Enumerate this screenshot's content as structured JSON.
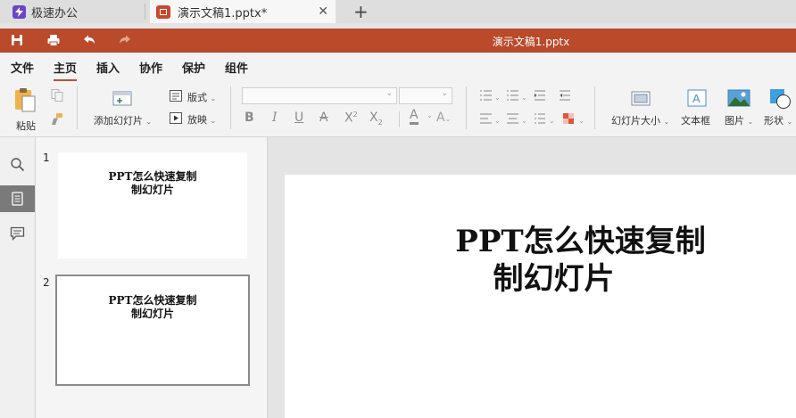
{
  "tabs": [
    {
      "label": "极速办公"
    },
    {
      "label": "演示文稿1.pptx*"
    }
  ],
  "titlebar": {
    "title": "演示文稿1.pptx"
  },
  "menu": [
    "文件",
    "主页",
    "插入",
    "协作",
    "保护",
    "组件"
  ],
  "ribbon": {
    "paste": "粘贴",
    "add_slide": "添加幻灯片",
    "layout": "版式",
    "play": "放映",
    "slide_size": "幻灯片大小",
    "textbox": "文本框",
    "image": "图片",
    "shape": "形状"
  },
  "slides": [
    {
      "number": "1",
      "line1": "PPT怎么快速复制",
      "line2": "制幻灯片"
    },
    {
      "number": "2",
      "line1": "PPT怎么快速复制",
      "line2": "制幻灯片"
    }
  ],
  "main_slide": {
    "line1": "PPT怎么快速复制",
    "line2": "制幻灯片"
  },
  "colors": {
    "accent": "#b94a2a",
    "brand_icon": "#6a45c8"
  }
}
